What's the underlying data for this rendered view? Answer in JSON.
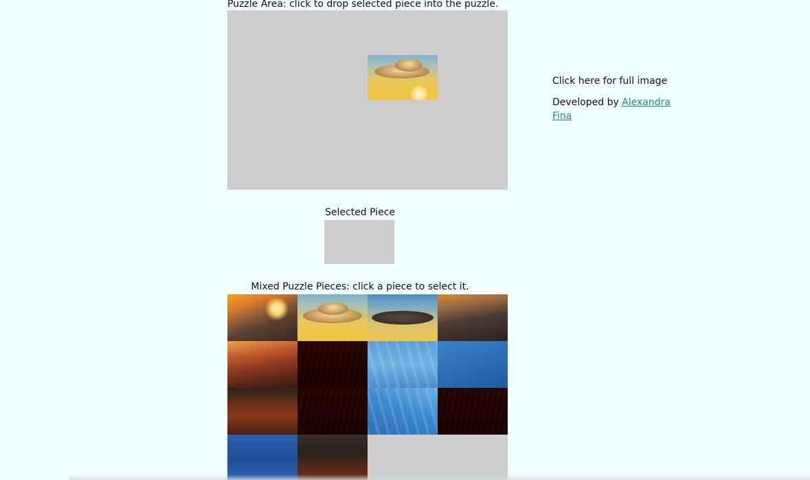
{
  "puzzle_area": {
    "label": "Puzzle Area: click to drop selected piece into the puzzle."
  },
  "selected": {
    "label": "Selected Piece"
  },
  "mixed": {
    "label": "Mixed Puzzle Pieces: click a piece to select it."
  },
  "side": {
    "full_image": "Click here for full image",
    "developed_by": "Developed by",
    "developer": "Alexandra Fina"
  },
  "colors": {
    "background": "#f0fffe",
    "empty_slot": "#cdcdcd",
    "link": "#1a8d8d"
  }
}
